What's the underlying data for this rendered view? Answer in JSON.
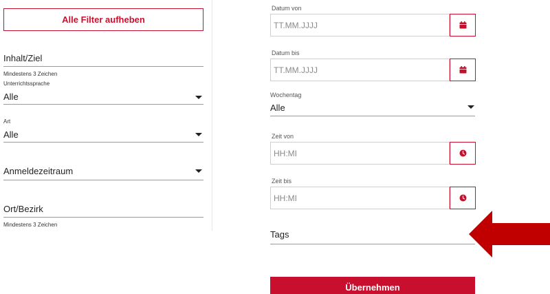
{
  "left": {
    "reset_button": "Alle Filter aufheben",
    "inhalt_label": "Inhalt/Ziel",
    "inhalt_hint": "Mindestens 3 Zeichen",
    "sprache_label": "Unterrichtssprache",
    "sprache_value": "Alle",
    "art_label": "Art",
    "art_value": "Alle",
    "anmelde_label": "Anmeldezeitraum",
    "ort_label": "Ort/Bezirk",
    "ort_hint": "Mindestens 3 Zeichen"
  },
  "right": {
    "datum_von_label": "Datum von",
    "datum_von_placeholder": "TT.MM.JJJJ",
    "datum_bis_label": "Datum bis",
    "datum_bis_placeholder": "TT.MM.JJJJ",
    "wochentag_label": "Wochentag",
    "wochentag_value": "Alle",
    "zeit_von_label": "Zeit von",
    "zeit_von_placeholder": "HH:MI",
    "zeit_bis_label": "Zeit bis",
    "zeit_bis_placeholder": "HH:MI",
    "tags_label": "Tags",
    "submit_button": "Übernehmen"
  },
  "colors": {
    "accent": "#c8102e",
    "arrow": "#c00000"
  },
  "icons": {
    "calendar": "calendar-icon",
    "clock": "clock-icon",
    "dropdown": "chevron-down-icon"
  }
}
